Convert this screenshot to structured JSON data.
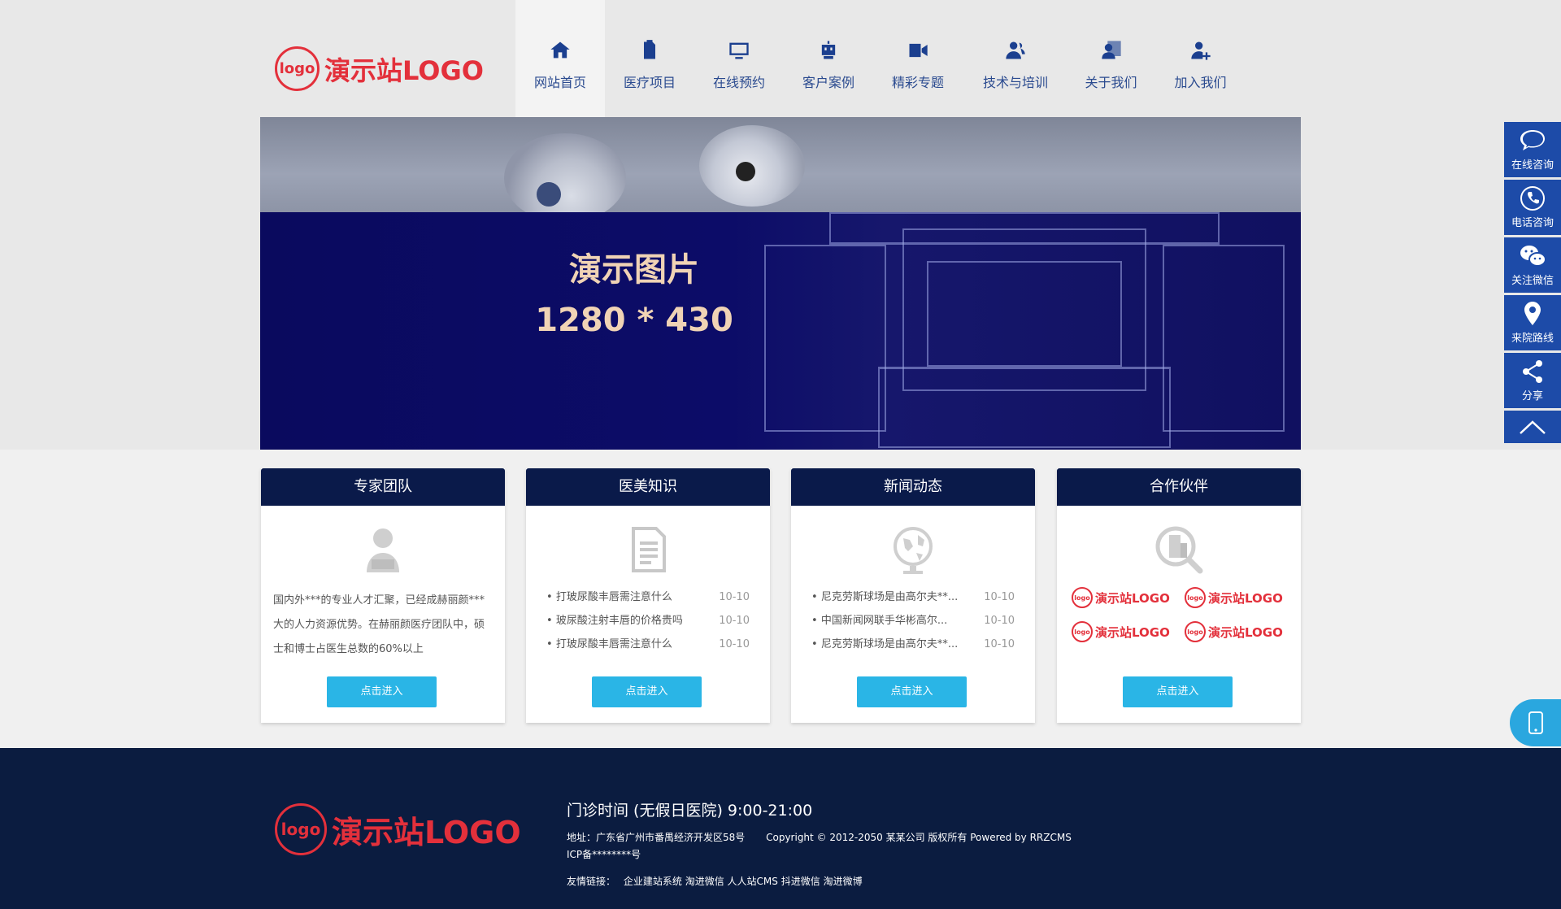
{
  "header": {
    "logo_mark": "logo",
    "logo_text": "演示站LOGO",
    "nav": [
      {
        "label": "网站首页",
        "icon": "home-icon",
        "active": true
      },
      {
        "label": "医疗项目",
        "icon": "clipboard-icon",
        "active": false
      },
      {
        "label": "在线预约",
        "icon": "monitor-icon",
        "active": false
      },
      {
        "label": "客户案例",
        "icon": "robot-icon",
        "active": false
      },
      {
        "label": "精彩专题",
        "icon": "video-icon",
        "active": false
      },
      {
        "label": "技术与培训",
        "icon": "team-icon",
        "active": false
      },
      {
        "label": "关于我们",
        "icon": "user-card-icon",
        "active": false
      },
      {
        "label": "加入我们",
        "icon": "user-add-icon",
        "active": false
      }
    ]
  },
  "banner": {
    "title": "演示图片",
    "size": "1280 * 430"
  },
  "cards": [
    {
      "title": "专家团队",
      "icon": "person-icon",
      "text": "国内外***的专业人才汇聚，已经成赫丽颜***大的人力资源优势。在赫丽颜医疗团队中，硕士和博士占医生总数的60%以上",
      "button": "点击进入"
    },
    {
      "title": "医美知识",
      "icon": "document-icon",
      "items": [
        {
          "title": "打玻尿酸丰唇需注意什么",
          "date": "10-10"
        },
        {
          "title": "玻尿酸注射丰唇的价格贵吗",
          "date": "10-10"
        },
        {
          "title": "打玻尿酸丰唇需注意什么",
          "date": "10-10"
        }
      ],
      "button": "点击进入"
    },
    {
      "title": "新闻动态",
      "icon": "globe-icon",
      "items": [
        {
          "title": "尼克劳斯球场是由高尔夫**...",
          "date": "10-10"
        },
        {
          "title": "中国新闻网联手华彬高尔...",
          "date": "10-10"
        },
        {
          "title": "尼克劳斯球场是由高尔夫**...",
          "date": "10-10"
        }
      ],
      "button": "点击进入"
    },
    {
      "title": "合作伙伴",
      "icon": "search-building-icon",
      "partners": [
        {
          "mark": "logo",
          "text": "演示站LOGO"
        },
        {
          "mark": "logo",
          "text": "演示站LOGO"
        },
        {
          "mark": "logo",
          "text": "演示站LOGO"
        },
        {
          "mark": "logo",
          "text": "演示站LOGO"
        }
      ],
      "button": "点击进入"
    }
  ],
  "footer": {
    "logo_mark": "logo",
    "logo_text": "演示站LOGO",
    "hours": "门诊时间 (无假日医院) 9:00-21:00",
    "address": "地址：广东省广州市番禺经济开发区58号",
    "copyright": "Copyright © 2012-2050 某某公司 版权所有 Powered by RRZCMS",
    "icp": "ICP备********号",
    "links_label": "友情链接：",
    "links": [
      "企业建站系统",
      "淘进微信",
      "人人站CMS",
      "抖进微信",
      "淘进微博"
    ]
  },
  "sidebar": [
    {
      "label": "在线咨询",
      "icon": "chat-bubble-icon"
    },
    {
      "label": "电话咨询",
      "icon": "phone-icon"
    },
    {
      "label": "关注微信",
      "icon": "wechat-icon"
    },
    {
      "label": "来院路线",
      "icon": "location-pin-icon"
    },
    {
      "label": "分享",
      "icon": "share-icon"
    }
  ],
  "colors": {
    "brand_red": "#e3303b",
    "nav_blue": "#1b3f8f",
    "card_head": "#0a1a4a",
    "button": "#2ab5e6",
    "footer": "#0b1c40",
    "sidebar": "#1d4ba8",
    "banner_text": "#f0d3b5"
  }
}
